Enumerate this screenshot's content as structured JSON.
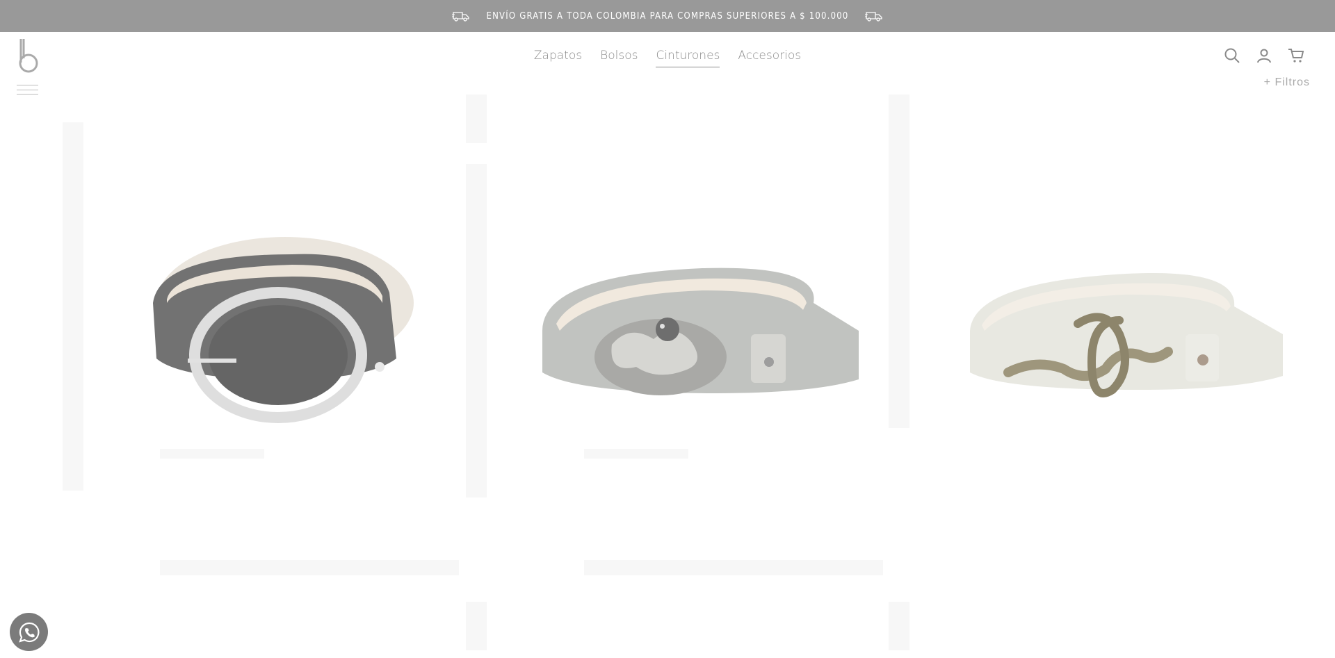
{
  "promo": {
    "text": "ENVÍO GRATIS A TODA COLOMBIA PARA COMPRAS SUPERIORES A $ 100.000",
    "left_icon": "truck-icon",
    "right_icon": "truck-icon"
  },
  "header": {
    "logo_icon": "brand-logo",
    "menu_icon": "hamburger-icon",
    "nav": [
      {
        "label": "Zapatos",
        "active": false
      },
      {
        "label": "Bolsos",
        "active": false
      },
      {
        "label": "Cinturones",
        "active": true
      },
      {
        "label": "Accesorios",
        "active": false
      }
    ],
    "icons": [
      "search-icon",
      "user-icon",
      "cart-icon"
    ],
    "filters_label": "+ Filtros"
  },
  "products": [
    {
      "name": "belt-black-round-buckle",
      "color": "#4a4a4a"
    },
    {
      "name": "belt-croc-octopus-buckle",
      "color": "#9fa5a8"
    },
    {
      "name": "belt-white-snake-buckle",
      "color": "#d9d9d0"
    }
  ],
  "floating": {
    "whatsapp_icon": "whatsapp-icon",
    "whatsapp_color": "#7b7b7b"
  }
}
